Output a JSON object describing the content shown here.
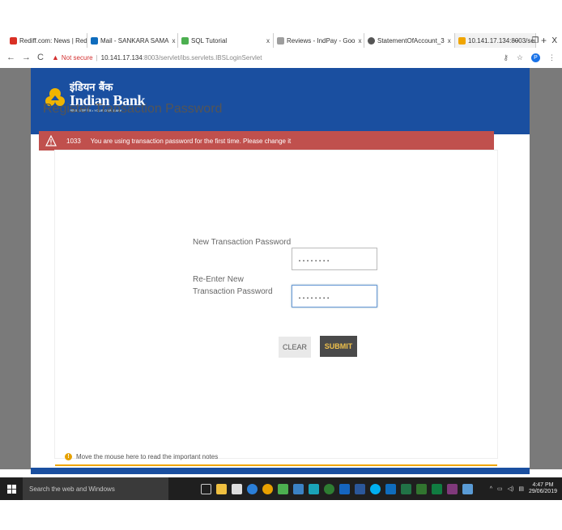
{
  "browser": {
    "tabs": [
      {
        "label": "Rediff.com: News | Redi",
        "color": "#d93025"
      },
      {
        "label": "Mail - SANKARA SAMA",
        "color": "#0f6cbd"
      },
      {
        "label": "SQL Tutorial",
        "color": "#4caf50"
      },
      {
        "label": "Reviews - IndPay - Goo",
        "color": "#9e9e9e"
      },
      {
        "label": "StatementOfAccount_3",
        "color": "#555555"
      },
      {
        "label": "10.141.17.134:8003/ser",
        "color": "#f0a500"
      }
    ],
    "new_tab": "+",
    "tab_close": "x",
    "window_controls": {
      "minimize": "–",
      "restore": "❐",
      "close": "X"
    },
    "address": {
      "warning": "Not secure",
      "host": "10.141.17.134",
      "path": ":8003/servlet/ibs.servlets.IBSLoginServlet"
    },
    "profile_initial": "P"
  },
  "bank": {
    "name_hindi": "इंडियन बैंक",
    "name_english": "Indian Bank",
    "tagline": "आपका अपना बैंक  •  YOUR OWN BANK",
    "brand_color": "#1a4fa0"
  },
  "page": {
    "title": "Register Transaction Password",
    "alert": {
      "code": "1033",
      "message": "You are using transaction password for the first time. Please change it"
    },
    "form": {
      "new_password_label": "New Transaction Password",
      "new_password_value": "........",
      "reenter_label": "Re-Enter New Transaction Password",
      "reenter_value": "........",
      "clear_label": "CLEAR",
      "submit_label": "SUBMIT"
    },
    "notes": "Move the mouse here to read the important notes"
  },
  "taskbar": {
    "search_placeholder": "Search the web and Windows",
    "time": "4:47 PM",
    "date": "29/06/2019"
  }
}
